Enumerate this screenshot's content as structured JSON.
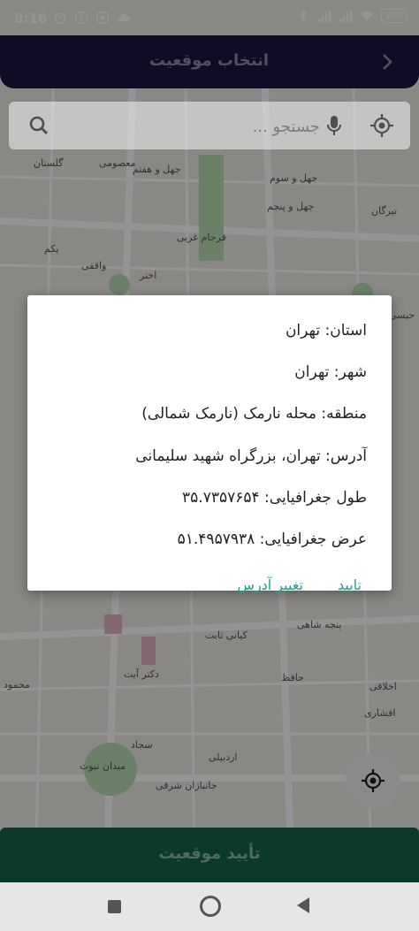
{
  "status": {
    "time": "8:16",
    "battery": "100"
  },
  "appbar": {
    "title": "انتخاب موقعیت"
  },
  "search": {
    "placeholder": "جستجو ..."
  },
  "map": {
    "labels": [
      "معصومی",
      "جهل و هفتم",
      "جهل و پنجم",
      "جهل و سوم",
      "گلستان",
      "فرجام غربی",
      "یکم",
      "واقفی",
      "اختر",
      "تیرگان",
      "حیسی"
    ]
  },
  "dialog": {
    "province": "استان: تهران",
    "city": "شهر: تهران",
    "region": "منطقه: محله نارمک (نارمک شمالی)",
    "address": "آدرس: تهران، بزرگراه شهید سلیمانی",
    "longitude": "طول جغرافیایی: ۳۵.۷۳۵۷۶۵۴",
    "latitude": "عرض جغرافیایی: ۵۱.۴۹۵۷۹۳۸",
    "confirm": "تایید",
    "change": "تغییر آدرس"
  },
  "map_bottom": {
    "labels": [
      "محمود",
      "کیانی ثابت",
      "پنجه شاهی",
      "دکتر آیت",
      "سجاد",
      "اردبیلی",
      "جانبازان شرقی",
      "میدان نبوت",
      "اخلاقی",
      "افشاری",
      "حافظ"
    ]
  },
  "bottom": {
    "confirm_location": "تأیید موقعیت"
  }
}
